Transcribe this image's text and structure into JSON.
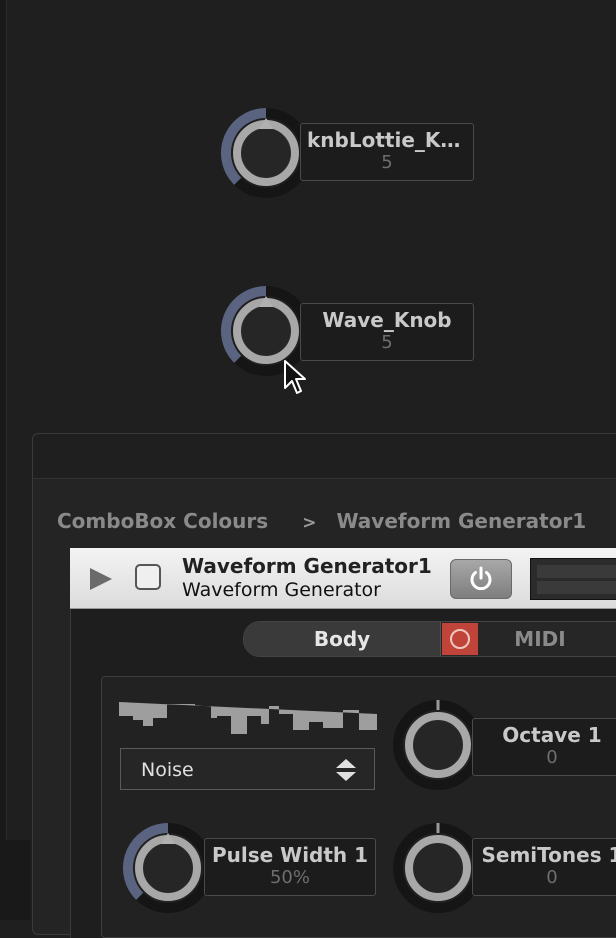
{
  "knobs_top": [
    {
      "name": "knbLottie_Kn...",
      "value": "5"
    },
    {
      "name": "Wave_Knob",
      "value": "5"
    }
  ],
  "breadcrumb": {
    "root": "ComboBox Colours",
    "separator": ">",
    "current": "Waveform Generator1"
  },
  "module": {
    "title": "Waveform Generator1",
    "subtitle": "Waveform Generator"
  },
  "tabs": {
    "body": "Body",
    "midi": "MIDI"
  },
  "combobox": {
    "value": "Noise"
  },
  "params": [
    {
      "name": "Octave 1",
      "value": "0"
    },
    {
      "name": "Pulse Width 1",
      "value": "50%"
    },
    {
      "name": "SemiTones 1",
      "value": "0"
    }
  ],
  "colors": {
    "accent": "#5a6480",
    "midi": "#c1443a"
  },
  "icons": [
    "play-icon",
    "power-icon",
    "midi-icon",
    "updown-arrows-icon",
    "cursor-icon"
  ]
}
